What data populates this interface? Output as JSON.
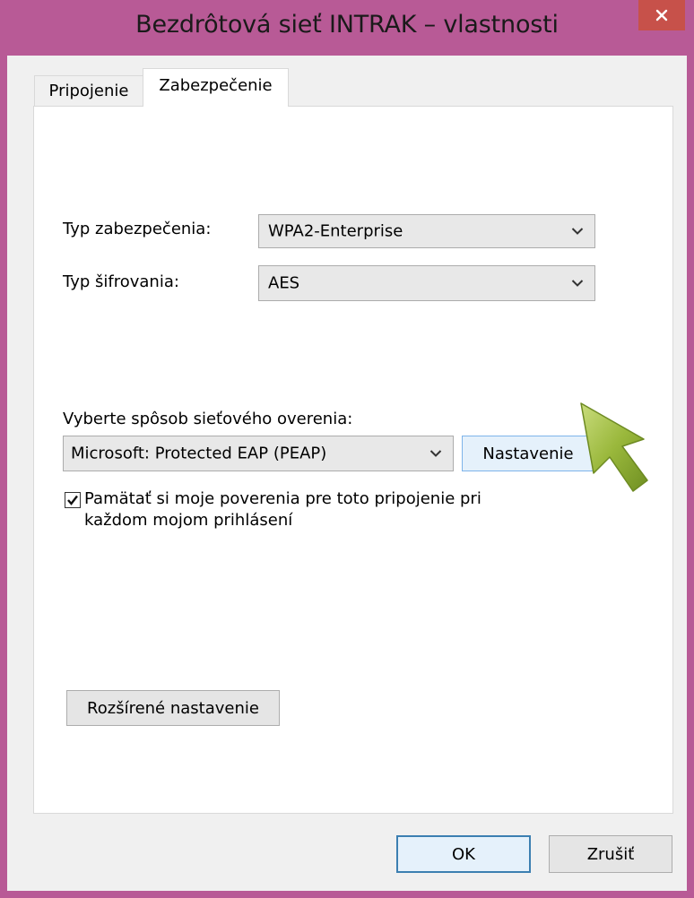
{
  "window": {
    "title": "Bezdrôtová sieť INTRAK – vlastnosti",
    "close_icon": "close-icon",
    "frame_color": "#b85a96",
    "close_color": "#c7514a"
  },
  "tabs": [
    {
      "label": "Pripojenie",
      "active": false
    },
    {
      "label": "Zabezpečenie",
      "active": true
    }
  ],
  "security": {
    "type_label": "Typ zabezpečenia:",
    "type_value": "WPA2-Enterprise",
    "encryption_label": "Typ šifrovania:",
    "encryption_value": "AES",
    "auth_method_label": "Vyberte spôsob sieťového overenia:",
    "auth_method_value": "Microsoft: Protected EAP (PEAP)",
    "settings_button": "Nastavenie",
    "remember_checked": true,
    "remember_label_line1": "Pamätať si moje poverenia pre toto pripojenie pri",
    "remember_label_line2": "každom mojom prihlásení",
    "advanced_button": "Rozšírené nastavenie"
  },
  "footer": {
    "ok_button": "OK",
    "cancel_button": "Zrušiť"
  },
  "annotation": {
    "pointer_icon": "green-arrow-pointer-icon",
    "pointer_color": "#8fb134"
  }
}
